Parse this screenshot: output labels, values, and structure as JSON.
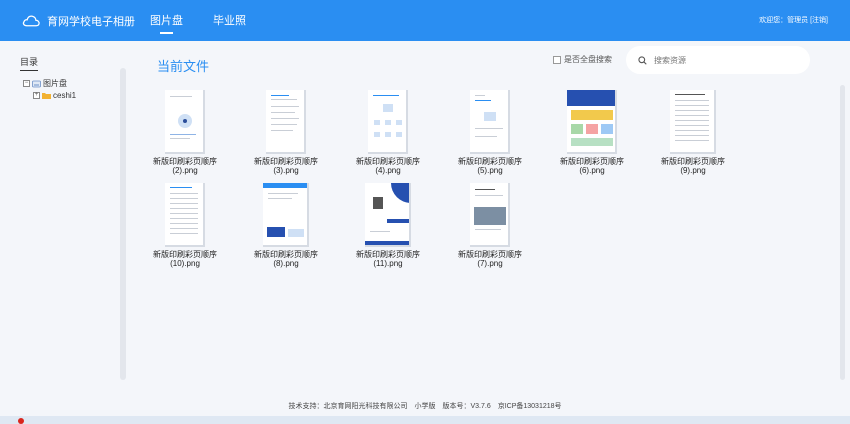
{
  "header": {
    "app_title": "育网学校电子相册",
    "tabs": [
      {
        "label": "图片盘",
        "active": true
      },
      {
        "label": "毕业照",
        "active": false
      }
    ],
    "user_text": "欢迎您：管理员 [注销]"
  },
  "sidebar": {
    "title": "目录",
    "tree": [
      {
        "label": "图片盘",
        "expanded": true,
        "icon": "disk-icon"
      },
      {
        "label": "ceshi1",
        "expanded": false,
        "icon": "folder-icon"
      }
    ]
  },
  "main": {
    "title": "当前文件",
    "global_search_label": "是否全盘搜索",
    "search_placeholder": "搜索资源",
    "files": [
      {
        "line1": "新版印刷彩页顺序",
        "line2": "(2).png"
      },
      {
        "line1": "新版印刷彩页顺序",
        "line2": "(3).png"
      },
      {
        "line1": "新版印刷彩页顺序",
        "line2": "(4).png"
      },
      {
        "line1": "新版印刷彩页顺序",
        "line2": "(5).png"
      },
      {
        "line1": "新版印刷彩页顺序",
        "line2": "(6).png"
      },
      {
        "line1": "新版印刷彩页顺序",
        "line2": "(9).png"
      },
      {
        "line1": "新版印刷彩页顺序",
        "line2": "(10).png"
      },
      {
        "line1": "新版印刷彩页顺序",
        "line2": "(8).png"
      },
      {
        "line1": "新版印刷彩页顺序",
        "line2": "(11).png"
      },
      {
        "line1": "新版印刷彩页顺序",
        "line2": "(7).png"
      }
    ]
  },
  "footer": {
    "text": "技术支持：北京育网阳光科技有限公司　小学版　版本号：V3.7.6　京ICP备13031218号"
  },
  "colors": {
    "accent": "#2a8ef2",
    "background": "#f4f6fa"
  }
}
